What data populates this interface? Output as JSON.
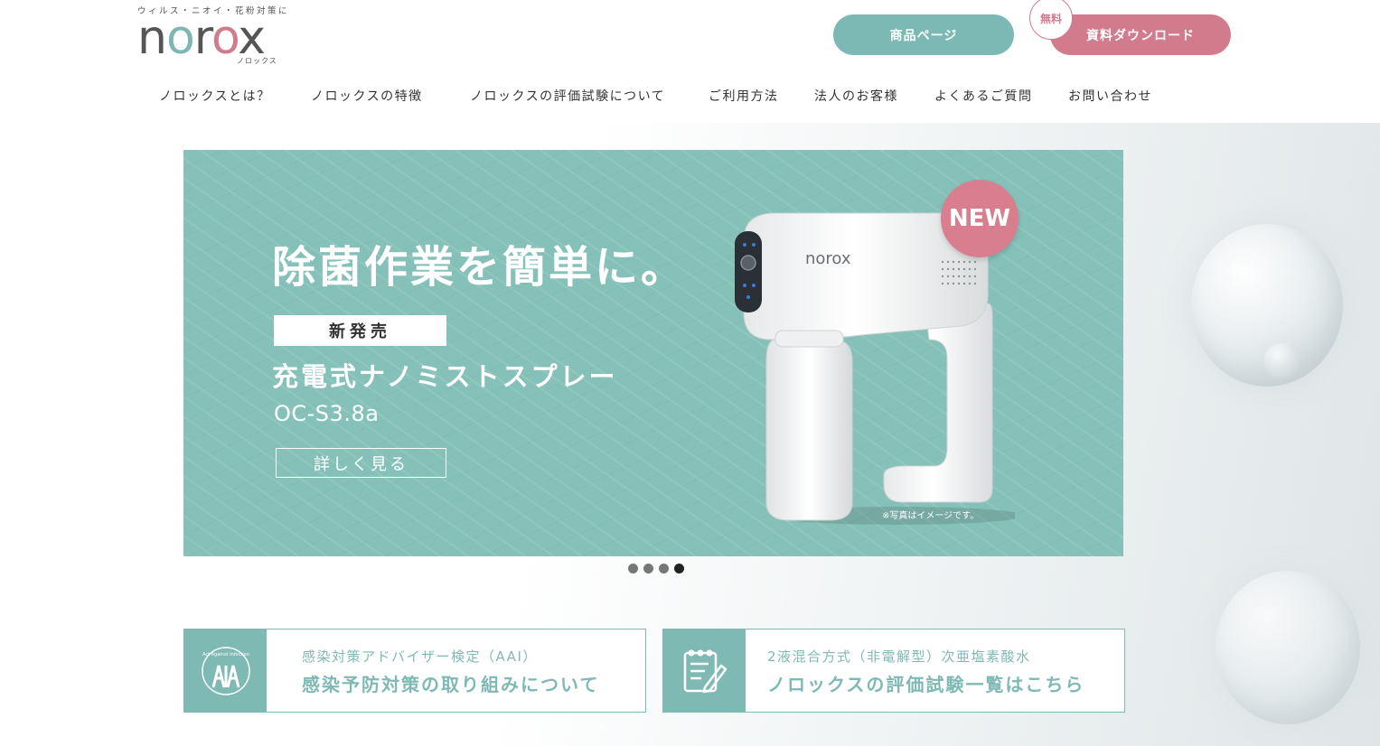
{
  "header": {
    "tagline": "ウィルス・ニオイ・花粉対策に",
    "logo_kana": "ノロックス",
    "product_button": "商品ページ",
    "download_button": "資料ダウンロード",
    "free_badge": "無料"
  },
  "nav": {
    "items": [
      {
        "label": "ノロックスとは？"
      },
      {
        "label": "ノロックスの特徴"
      },
      {
        "label": "ノロックスの評価試験について"
      },
      {
        "label": "ご利用方法"
      },
      {
        "label": "法人のお客様"
      },
      {
        "label": "よくあるご質問"
      },
      {
        "label": "お問い合わせ"
      }
    ]
  },
  "hero": {
    "headline": "除菌作業を簡単に。",
    "tag": "新発売",
    "subtitle": "充電式ナノミストスプレー",
    "model": "OC-S3.8a",
    "more_button": "詳しく見る",
    "new_badge": "NEW",
    "note": "※写真はイメージです。",
    "product_brand": "norox",
    "slide_count": 4,
    "active_slide": 4
  },
  "cards": [
    {
      "icon": "aai-logo-icon",
      "small": "感染対策アドバイザー検定（AAI）",
      "big": "感染予防対策の取り組みについて",
      "icon_text": "Act Against Infection"
    },
    {
      "icon": "checklist-pencil-icon",
      "small": "2液混合方式（非電解型）次亜塩素酸水",
      "big": "ノロックスの評価試験一覧はこちら"
    }
  ],
  "colors": {
    "teal": "#7cb8b4",
    "pink": "#d27b8d",
    "hero_bg": "#86c1b9"
  }
}
